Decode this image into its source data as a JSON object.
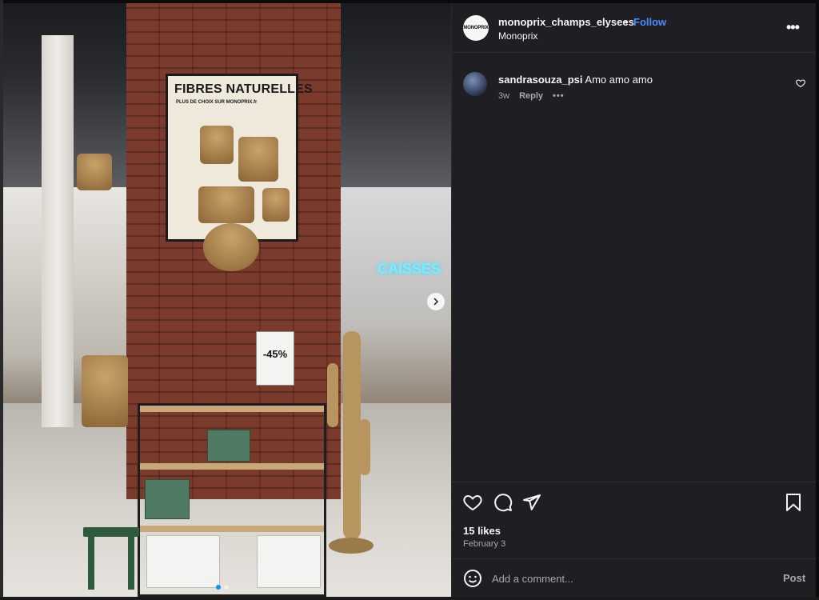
{
  "post": {
    "image": {
      "poster_title": "FIBRES NATURELLES",
      "poster_subtitle": "PLUS DE CHOIX SUR MONOPRIX.fr",
      "neon_sign": "CAISSES",
      "price_tag": "-45%",
      "carousel": {
        "total": 2,
        "active_index": 0
      }
    }
  },
  "header": {
    "avatar_text": "MONOPRIX",
    "username": "monoprix_champs_elysees",
    "separator": "•",
    "follow_label": "Follow",
    "subname": "Monoprix",
    "more_label": "•••"
  },
  "comments": [
    {
      "username": "sandrasouza_psi",
      "text": "Amo amo amo",
      "time": "3w",
      "reply_label": "Reply",
      "more_label": "•••"
    }
  ],
  "stats": {
    "likes": "15 likes",
    "date": "February 3"
  },
  "composer": {
    "placeholder": "Add a comment...",
    "post_label": "Post"
  },
  "icons": {
    "like": "heart-icon",
    "comment": "comment-icon",
    "share": "share-icon",
    "save": "bookmark-icon",
    "emoji": "emoji-icon",
    "next": "chevron-right-icon"
  },
  "colors": {
    "panel_bg": "#1f1f23",
    "follow": "#4a8cff",
    "secondary_text": "#a8a8a8",
    "neon": "#7fe9ff"
  }
}
